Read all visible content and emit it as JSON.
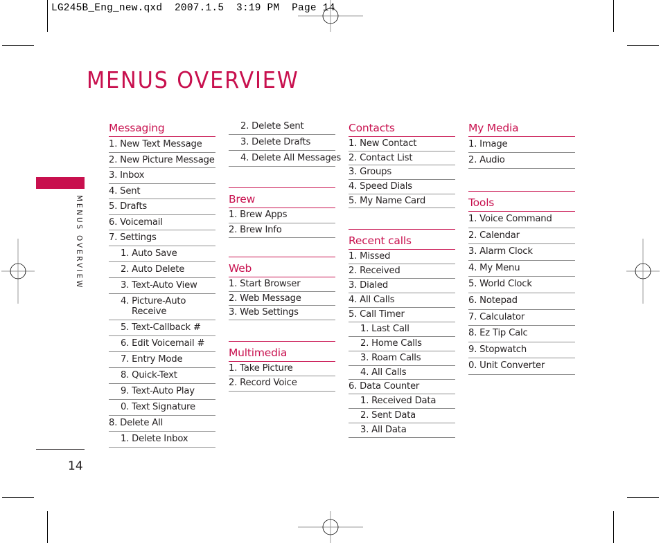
{
  "slug": "LG245B_Eng_new.qxd  2007.1.5  3:19 PM  Page 14",
  "title": "MENUS OVERVIEW",
  "side_label": "MENUS OVERVIEW",
  "page_number": "14",
  "colors": {
    "accent": "#c8104e",
    "rule": "#8c8c8c",
    "text": "#231f20"
  },
  "columns": [
    {
      "sections": [
        {
          "heading": "Messaging",
          "items": [
            {
              "text": "1. New Text Message",
              "level": 0
            },
            {
              "text": "2. New Picture Message",
              "level": 0
            },
            {
              "text": "3. Inbox",
              "level": 0
            },
            {
              "text": "4. Sent",
              "level": 0
            },
            {
              "text": "5. Drafts",
              "level": 0
            },
            {
              "text": "6. Voicemail",
              "level": 0
            },
            {
              "text": "7. Settings",
              "level": 0
            },
            {
              "text": "1. Auto Save",
              "level": 1
            },
            {
              "text": "2. Auto Delete",
              "level": 1
            },
            {
              "text": "3. Text-Auto View",
              "level": 1
            },
            {
              "text": "4. Picture-Auto",
              "cont": "Receive",
              "level": 1
            },
            {
              "text": "5. Text-Callback #",
              "level": 1
            },
            {
              "text": "6. Edit Voicemail #",
              "level": 1
            },
            {
              "text": "7. Entry Mode",
              "level": 1
            },
            {
              "text": "8. Quick-Text",
              "level": 1
            },
            {
              "text": "9. Text-Auto Play",
              "level": 1
            },
            {
              "text": "0. Text Signature",
              "level": 1
            },
            {
              "text": "8. Delete All",
              "level": 0
            },
            {
              "text": "1. Delete Inbox",
              "level": 1
            }
          ]
        }
      ]
    },
    {
      "sections": [
        {
          "heading": null,
          "items": [
            {
              "text": "2. Delete Sent",
              "level": 1
            },
            {
              "text": "3. Delete Drafts",
              "level": 1
            },
            {
              "text": "4. Delete All Messages",
              "level": 1
            }
          ]
        },
        {
          "heading": "Brew",
          "items": [
            {
              "text": "1. Brew Apps",
              "level": 0
            },
            {
              "text": "2. Brew Info",
              "level": 0
            }
          ]
        },
        {
          "heading": "Web",
          "items": [
            {
              "text": "1. Start Browser",
              "level": 0
            },
            {
              "text": "2. Web Message",
              "level": 0
            },
            {
              "text": "3. Web Settings",
              "level": 0
            }
          ]
        },
        {
          "heading": "Multimedia",
          "items": [
            {
              "text": "1. Take Picture",
              "level": 0
            },
            {
              "text": "2. Record Voice",
              "level": 0
            }
          ]
        }
      ]
    },
    {
      "sections": [
        {
          "heading": "Contacts",
          "items": [
            {
              "text": "1. New Contact",
              "level": 0
            },
            {
              "text": "2. Contact List",
              "level": 0
            },
            {
              "text": "3. Groups",
              "level": 0
            },
            {
              "text": "4. Speed Dials",
              "level": 0
            },
            {
              "text": "5. My Name Card",
              "level": 0
            }
          ]
        },
        {
          "heading": "Recent calls",
          "items": [
            {
              "text": "1. Missed",
              "level": 0
            },
            {
              "text": "2. Received",
              "level": 0
            },
            {
              "text": "3. Dialed",
              "level": 0
            },
            {
              "text": "4. All Calls",
              "level": 0
            },
            {
              "text": "5. Call Timer",
              "level": 0
            },
            {
              "text": "1. Last Call",
              "level": 1
            },
            {
              "text": "2. Home Calls",
              "level": 1
            },
            {
              "text": "3. Roam Calls",
              "level": 1
            },
            {
              "text": "4. All Calls",
              "level": 1
            },
            {
              "text": "6. Data Counter",
              "level": 0
            },
            {
              "text": "1. Received Data",
              "level": 1
            },
            {
              "text": "2. Sent Data",
              "level": 1
            },
            {
              "text": "3. All Data",
              "level": 1
            }
          ]
        }
      ]
    },
    {
      "sections": [
        {
          "heading": "My Media",
          "items": [
            {
              "text": "1. Image",
              "level": 0
            },
            {
              "text": "2. Audio",
              "level": 0
            }
          ]
        },
        {
          "heading": "Tools",
          "items": [
            {
              "text": "1. Voice Command",
              "level": 0
            },
            {
              "text": "2. Calendar",
              "level": 0
            },
            {
              "text": "3. Alarm Clock",
              "level": 0
            },
            {
              "text": "4. My Menu",
              "level": 0
            },
            {
              "text": "5. World Clock",
              "level": 0
            },
            {
              "text": "6. Notepad",
              "level": 0
            },
            {
              "text": "7. Calculator",
              "level": 0
            },
            {
              "text": "8. Ez Tip Calc",
              "level": 0
            },
            {
              "text": "9. Stopwatch",
              "level": 0
            },
            {
              "text": "0. Unit Converter",
              "level": 0
            }
          ]
        }
      ]
    }
  ]
}
